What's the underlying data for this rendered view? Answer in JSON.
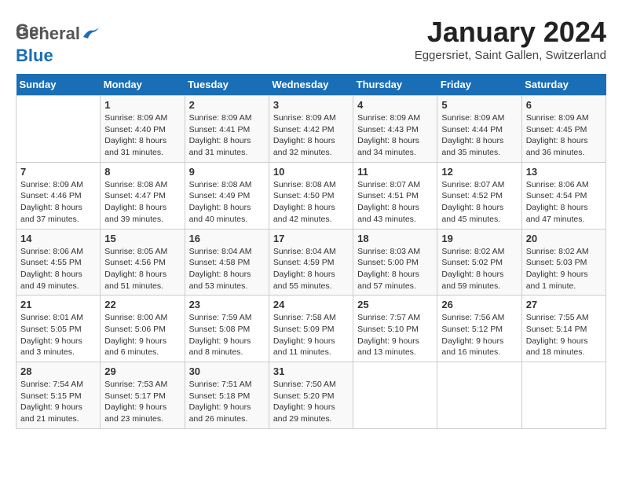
{
  "header": {
    "logo": {
      "line1": "General",
      "line2": "Blue"
    },
    "title": "January 2024",
    "location": "Eggersriet, Saint Gallen, Switzerland"
  },
  "days_of_week": [
    "Sunday",
    "Monday",
    "Tuesday",
    "Wednesday",
    "Thursday",
    "Friday",
    "Saturday"
  ],
  "weeks": [
    [
      {
        "day": null,
        "sunrise": null,
        "sunset": null,
        "daylight": null
      },
      {
        "day": "1",
        "sunrise": "8:09 AM",
        "sunset": "4:40 PM",
        "daylight": "8 hours and 31 minutes."
      },
      {
        "day": "2",
        "sunrise": "8:09 AM",
        "sunset": "4:41 PM",
        "daylight": "8 hours and 31 minutes."
      },
      {
        "day": "3",
        "sunrise": "8:09 AM",
        "sunset": "4:42 PM",
        "daylight": "8 hours and 32 minutes."
      },
      {
        "day": "4",
        "sunrise": "8:09 AM",
        "sunset": "4:43 PM",
        "daylight": "8 hours and 34 minutes."
      },
      {
        "day": "5",
        "sunrise": "8:09 AM",
        "sunset": "4:44 PM",
        "daylight": "8 hours and 35 minutes."
      },
      {
        "day": "6",
        "sunrise": "8:09 AM",
        "sunset": "4:45 PM",
        "daylight": "8 hours and 36 minutes."
      }
    ],
    [
      {
        "day": "7",
        "sunrise": "8:09 AM",
        "sunset": "4:46 PM",
        "daylight": "8 hours and 37 minutes."
      },
      {
        "day": "8",
        "sunrise": "8:08 AM",
        "sunset": "4:47 PM",
        "daylight": "8 hours and 39 minutes."
      },
      {
        "day": "9",
        "sunrise": "8:08 AM",
        "sunset": "4:49 PM",
        "daylight": "8 hours and 40 minutes."
      },
      {
        "day": "10",
        "sunrise": "8:08 AM",
        "sunset": "4:50 PM",
        "daylight": "8 hours and 42 minutes."
      },
      {
        "day": "11",
        "sunrise": "8:07 AM",
        "sunset": "4:51 PM",
        "daylight": "8 hours and 43 minutes."
      },
      {
        "day": "12",
        "sunrise": "8:07 AM",
        "sunset": "4:52 PM",
        "daylight": "8 hours and 45 minutes."
      },
      {
        "day": "13",
        "sunrise": "8:06 AM",
        "sunset": "4:54 PM",
        "daylight": "8 hours and 47 minutes."
      }
    ],
    [
      {
        "day": "14",
        "sunrise": "8:06 AM",
        "sunset": "4:55 PM",
        "daylight": "8 hours and 49 minutes."
      },
      {
        "day": "15",
        "sunrise": "8:05 AM",
        "sunset": "4:56 PM",
        "daylight": "8 hours and 51 minutes."
      },
      {
        "day": "16",
        "sunrise": "8:04 AM",
        "sunset": "4:58 PM",
        "daylight": "8 hours and 53 minutes."
      },
      {
        "day": "17",
        "sunrise": "8:04 AM",
        "sunset": "4:59 PM",
        "daylight": "8 hours and 55 minutes."
      },
      {
        "day": "18",
        "sunrise": "8:03 AM",
        "sunset": "5:00 PM",
        "daylight": "8 hours and 57 minutes."
      },
      {
        "day": "19",
        "sunrise": "8:02 AM",
        "sunset": "5:02 PM",
        "daylight": "8 hours and 59 minutes."
      },
      {
        "day": "20",
        "sunrise": "8:02 AM",
        "sunset": "5:03 PM",
        "daylight": "9 hours and 1 minute."
      }
    ],
    [
      {
        "day": "21",
        "sunrise": "8:01 AM",
        "sunset": "5:05 PM",
        "daylight": "9 hours and 3 minutes."
      },
      {
        "day": "22",
        "sunrise": "8:00 AM",
        "sunset": "5:06 PM",
        "daylight": "9 hours and 6 minutes."
      },
      {
        "day": "23",
        "sunrise": "7:59 AM",
        "sunset": "5:08 PM",
        "daylight": "9 hours and 8 minutes."
      },
      {
        "day": "24",
        "sunrise": "7:58 AM",
        "sunset": "5:09 PM",
        "daylight": "9 hours and 11 minutes."
      },
      {
        "day": "25",
        "sunrise": "7:57 AM",
        "sunset": "5:10 PM",
        "daylight": "9 hours and 13 minutes."
      },
      {
        "day": "26",
        "sunrise": "7:56 AM",
        "sunset": "5:12 PM",
        "daylight": "9 hours and 16 minutes."
      },
      {
        "day": "27",
        "sunrise": "7:55 AM",
        "sunset": "5:14 PM",
        "daylight": "9 hours and 18 minutes."
      }
    ],
    [
      {
        "day": "28",
        "sunrise": "7:54 AM",
        "sunset": "5:15 PM",
        "daylight": "9 hours and 21 minutes."
      },
      {
        "day": "29",
        "sunrise": "7:53 AM",
        "sunset": "5:17 PM",
        "daylight": "9 hours and 23 minutes."
      },
      {
        "day": "30",
        "sunrise": "7:51 AM",
        "sunset": "5:18 PM",
        "daylight": "9 hours and 26 minutes."
      },
      {
        "day": "31",
        "sunrise": "7:50 AM",
        "sunset": "5:20 PM",
        "daylight": "9 hours and 29 minutes."
      },
      {
        "day": null,
        "sunrise": null,
        "sunset": null,
        "daylight": null
      },
      {
        "day": null,
        "sunrise": null,
        "sunset": null,
        "daylight": null
      },
      {
        "day": null,
        "sunrise": null,
        "sunset": null,
        "daylight": null
      }
    ]
  ]
}
